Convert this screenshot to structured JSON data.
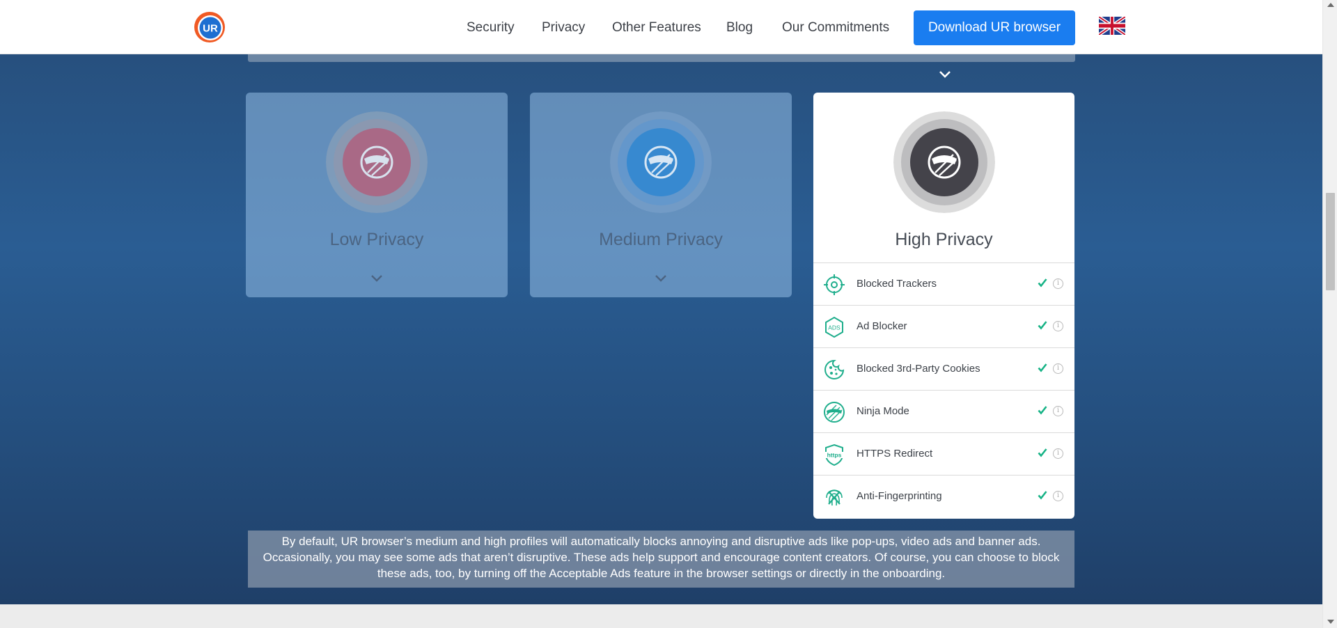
{
  "header": {
    "logo_text": "UR",
    "nav": [
      "Security",
      "Privacy",
      "Other Features",
      "Blog",
      "Our Commitments"
    ],
    "download_label": "Download UR browser",
    "language_flag": "uk-flag-icon"
  },
  "profiles": [
    {
      "title": "Low Privacy",
      "color": "#b35a78",
      "state": "collapsed"
    },
    {
      "title": "Medium Privacy",
      "color": "#2f86d0",
      "state": "collapsed"
    },
    {
      "title": "High Privacy",
      "color": "#44434a",
      "state": "expanded"
    }
  ],
  "features": [
    {
      "label": "Blocked Trackers",
      "icon": "tracker-target-icon",
      "enabled": true
    },
    {
      "label": "Ad Blocker",
      "icon": "ads-hexagon-icon",
      "enabled": true
    },
    {
      "label": "Blocked 3rd-Party Cookies",
      "icon": "cookie-icon",
      "enabled": true
    },
    {
      "label": "Ninja Mode",
      "icon": "ninja-icon",
      "enabled": true
    },
    {
      "label": "HTTPS Redirect",
      "icon": "https-shield-icon",
      "enabled": true
    },
    {
      "label": "Anti-Fingerprinting",
      "icon": "fingerprint-icon",
      "enabled": true
    }
  ],
  "note": "By default, UR browser’s medium and high profiles will automatically blocks annoying and disruptive ads like pop-ups, video ads and banner ads. Occasionally, you may see some ads that aren’t disruptive. These ads help support and encourage content creators. Of course, you can choose to block these ads, too, by turning off the Acceptable Ads feature in the browser settings or directly in the onboarding.",
  "colors": {
    "accent": "#1a7df0",
    "check": "#17b386",
    "feature_icon": "#1fae8c"
  }
}
